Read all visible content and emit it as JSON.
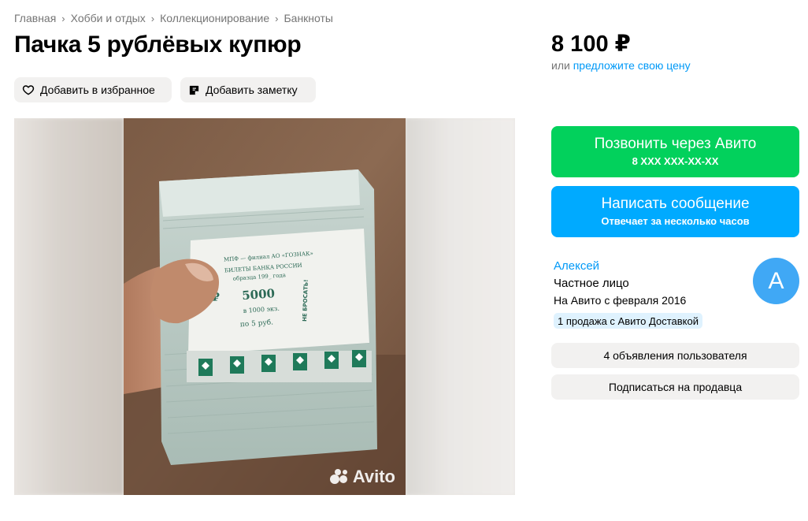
{
  "breadcrumbs": [
    "Главная",
    "Хобби и отдых",
    "Коллекционирование",
    "Банкноты"
  ],
  "breadcrumb_separator": "›",
  "title": "Пачка 5 рублёвых купюр",
  "price": {
    "amount": "8 100 ₽",
    "offer_prefix": "или",
    "offer_link": "предложите свою цену"
  },
  "actions": {
    "favorite_label": "Добавить в избранное",
    "note_label": "Добавить заметку"
  },
  "gallery": {
    "watermark": "Avito",
    "band_text": {
      "line1": "МПФ — филиал АО «ГОЗНАК»",
      "line2": "БИЛЕТЫ БАНКА РОССИИ",
      "line3": "образца 199_ года",
      "amount": "5000",
      "count": "в 1000 экз.",
      "denomination": "по 5 руб.",
      "side": "НЕ БРОСАТЬ!",
      "currency": "₽"
    }
  },
  "contact": {
    "call_label": "Позвонить через Авито",
    "call_phone": "8 XXX XXX-XX-XX",
    "message_label": "Написать сообщение",
    "message_sub": "Отвечает за несколько часов"
  },
  "seller": {
    "name": "Алексей",
    "type": "Частное лицо",
    "since": "На Авито с февраля 2016",
    "badge": "1 продажа с Авито Доставкой",
    "avatar_letter": "А",
    "listings_label": "4 объявления пользователя",
    "subscribe_label": "Подписаться на продавца"
  },
  "colors": {
    "call": "#02d15c",
    "message": "#00aaff",
    "link": "#0099f7",
    "avatar": "#40a8f5"
  }
}
